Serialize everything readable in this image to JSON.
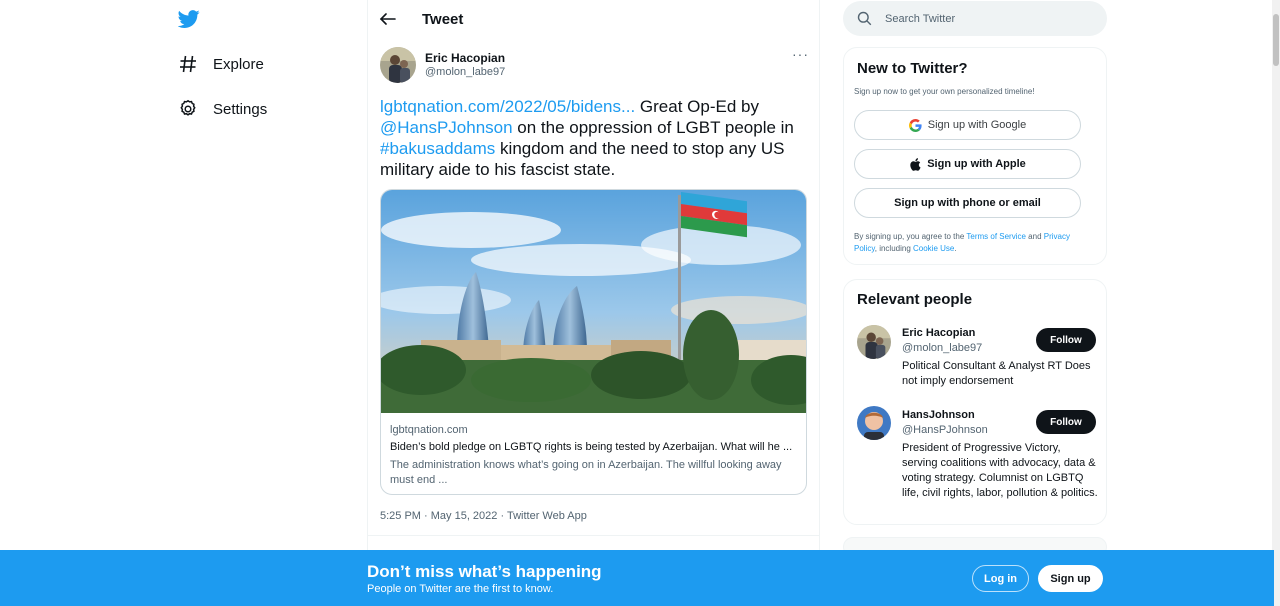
{
  "nav": {
    "logo_icon": "twitter-bird-icon",
    "items": [
      {
        "label": "Explore",
        "icon": "hashtag-icon"
      },
      {
        "label": "Settings",
        "icon": "gear-icon"
      }
    ]
  },
  "header": {
    "back_icon": "arrow-left-icon",
    "title": "Tweet"
  },
  "tweet": {
    "author_name": "Eric Hacopian",
    "author_handle": "@molon_labe97",
    "more_icon": "more-icon",
    "more_label": "···",
    "text": {
      "link": "lgbtqnation.com/2022/05/bidens...",
      "part1": " Great Op-Ed by ",
      "mention": "@HansPJohnson",
      "part2": " on the oppression of LGBT people in ",
      "hashtag": "#bakusaddams",
      "part3": " kingdom and the need to stop any US military aide to his fascist state."
    },
    "card": {
      "domain": "lgbtqnation.com",
      "title": "Biden’s bold pledge on LGBTQ rights is being tested by Azerbaijan. What will he ...",
      "description": "The administration knows what’s going on in Azerbaijan. The willful looking away must end ..."
    },
    "meta": "5:25 PM · May 15, 2022 · Twitter Web App"
  },
  "search": {
    "placeholder": "Search Twitter",
    "icon": "search-icon"
  },
  "new_to_twitter": {
    "title": "New to Twitter?",
    "subtitle": "Sign up now to get your own personalized timeline!",
    "google_label": "Sign up with Google",
    "apple_label": "Sign up with Apple",
    "phone_label": "Sign up with phone or email",
    "terms_prefix": "By signing up, you agree to the ",
    "terms_link": "Terms of Service",
    "terms_and": " and ",
    "privacy_link": "Privacy Policy",
    "terms_including": ", including ",
    "cookie_link": "Cookie Use",
    "terms_end": "."
  },
  "relevant_people": {
    "title": "Relevant people",
    "people": [
      {
        "name": "Eric Hacopian",
        "handle": "@molon_labe97",
        "bio": "Political Consultant & Analyst RT Does not imply endorsement",
        "follow_label": "Follow"
      },
      {
        "name": "HansJohnson",
        "handle": "@HansPJohnson",
        "bio": "President of Progressive Victory, serving coalitions with advocacy, data & voting strategy. Columnist on LGBTQ life, civil rights, labor, pollution & politics.",
        "follow_label": "Follow"
      }
    ]
  },
  "banner": {
    "title": "Don’t miss what’s happening",
    "subtitle": "People on Twitter are the first to know.",
    "login_label": "Log in",
    "signup_label": "Sign up"
  },
  "colors": {
    "accent": "#1d9bf0",
    "text": "#0f1419",
    "muted": "#536471"
  }
}
